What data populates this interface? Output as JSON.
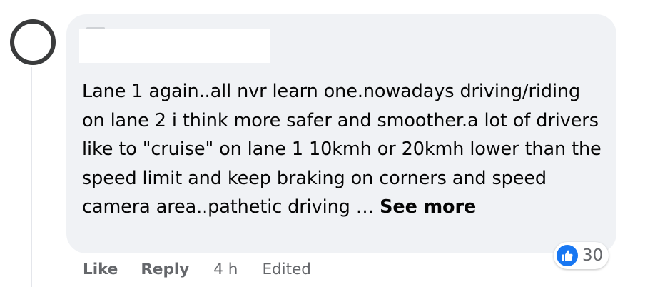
{
  "comment": {
    "author_redacted": true,
    "body": "Lane 1 again..all nvr learn one.nowadays driving/riding on lane 2 i think more safer and smoother.a lot of drivers like to \"cruise\" on lane 1 10kmh or 20kmh lower than the speed limit and keep braking on corners and speed camera area..pathetic driving … ",
    "see_more_label": "See more",
    "reactions": {
      "icon": "thumbs-up-icon",
      "count": "30",
      "icon_color": "#1877f2"
    },
    "actions": {
      "like_label": "Like",
      "reply_label": "Reply",
      "timestamp": "4 h",
      "edited_label": "Edited"
    }
  },
  "colors": {
    "bubble_bg": "#f0f2f5",
    "text": "#050505",
    "secondary_text": "#65676b",
    "accent": "#1877f2"
  }
}
